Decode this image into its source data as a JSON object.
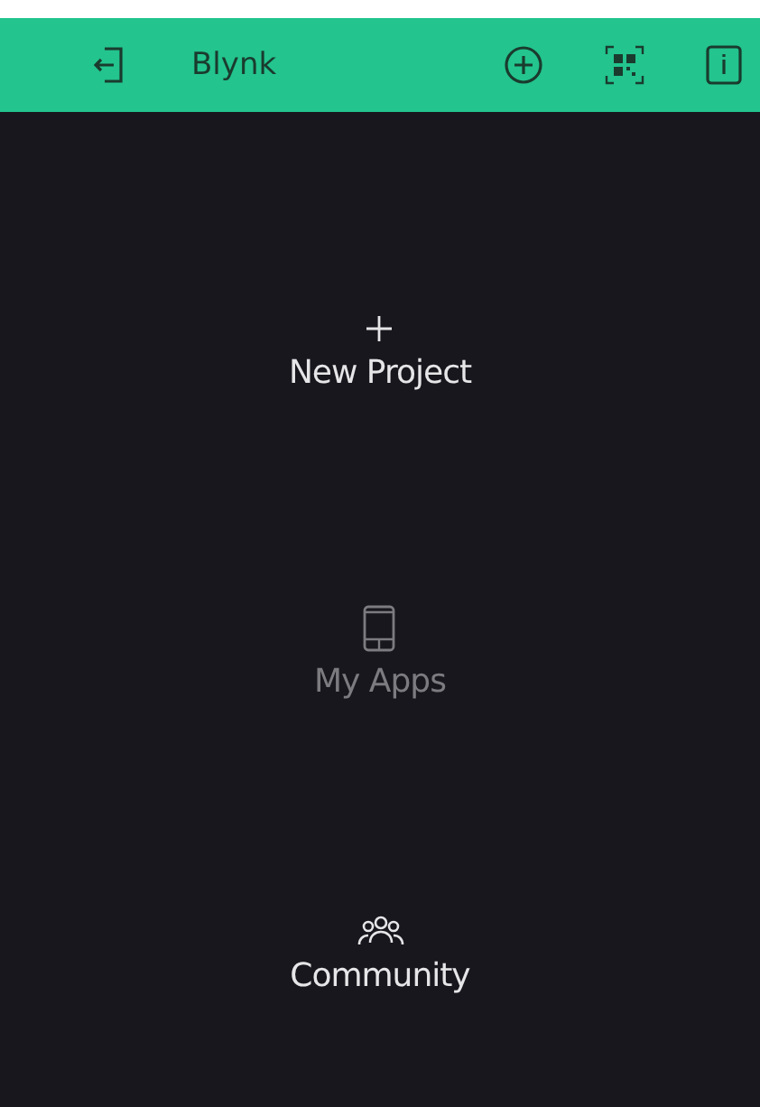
{
  "header": {
    "title": "Blynk"
  },
  "menu": [
    {
      "kind": "new",
      "label": "New Project",
      "disabled": false
    },
    {
      "kind": "apps",
      "label": "My Apps",
      "disabled": true
    },
    {
      "kind": "community",
      "label": "Community",
      "disabled": false
    }
  ]
}
